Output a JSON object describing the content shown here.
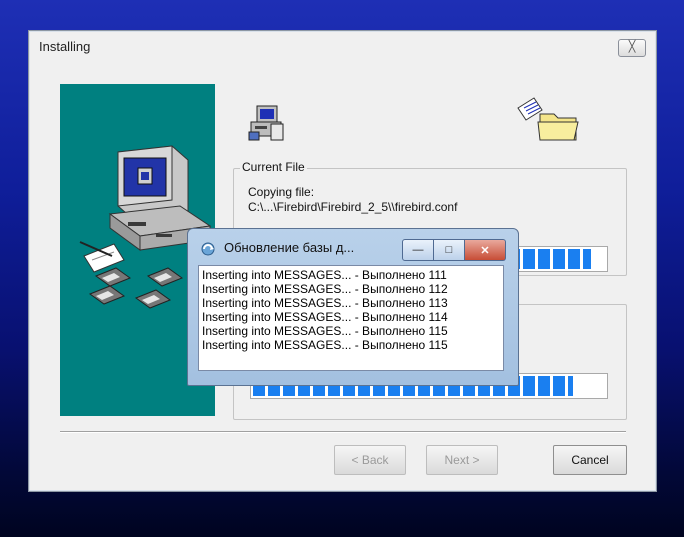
{
  "installer": {
    "title": "Installing",
    "close_glyph": "╳",
    "icons": [
      "computer-setup-icon",
      "installer-program-icon",
      "folder-with-document-icon"
    ],
    "current_file": {
      "legend": "Current File",
      "copying_label": "Copying file:",
      "path": "C:\\...\\Firebird\\Firebird_2_5\\\\firebird.conf",
      "progress": 0.95
    },
    "overall_progress": 0.9,
    "buttons": {
      "back": "< Back",
      "next": "Next >",
      "cancel": "Cancel"
    }
  },
  "db_update": {
    "title": "Обновление базы д...",
    "log_lines": [
      "Inserting into MESSAGES... - Выполнено 111",
      "Inserting into MESSAGES... - Выполнено 112",
      "Inserting into MESSAGES... - Выполнено 113",
      "Inserting into MESSAGES... - Выполнено 114",
      "Inserting into MESSAGES... - Выполнено 115",
      "Inserting into MESSAGES... - Выполнено 115"
    ]
  },
  "colors": {
    "desktop_top": "#1e2fb5",
    "panel_teal": "#008080",
    "progress_blue": "#1a7ff0"
  }
}
